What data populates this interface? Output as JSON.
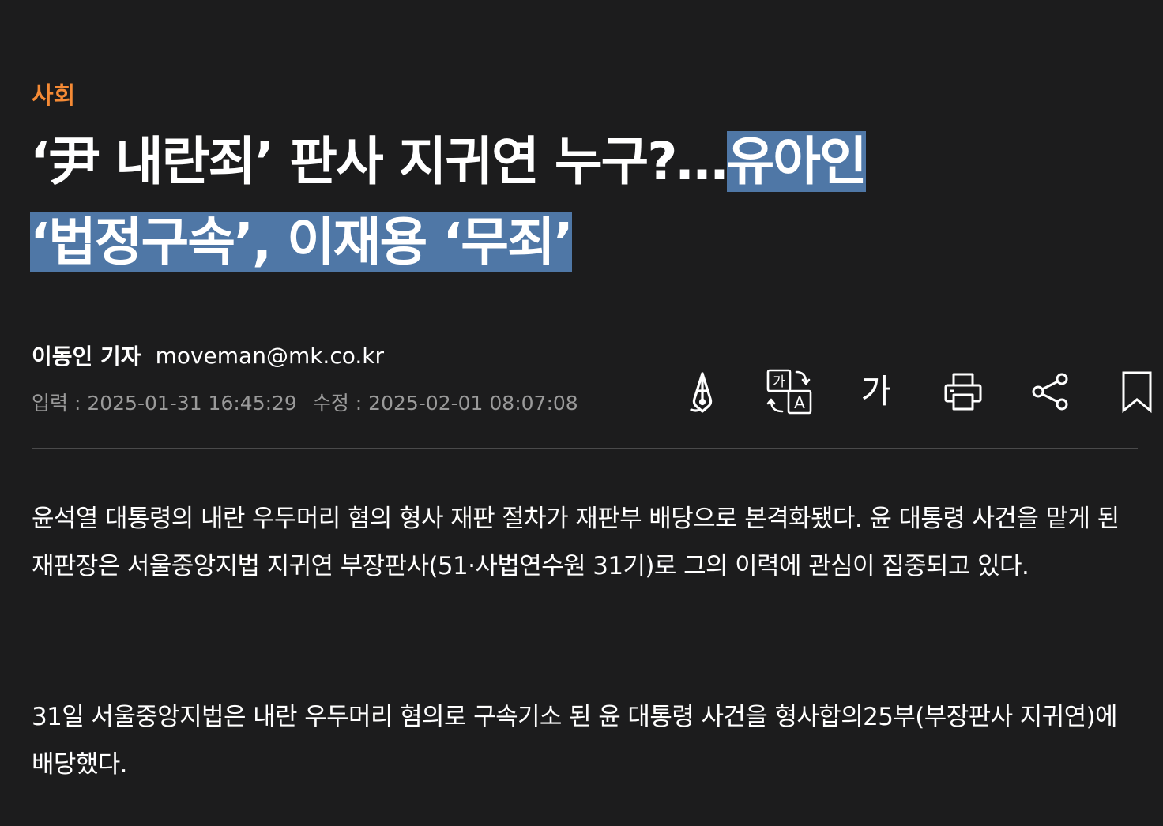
{
  "article": {
    "category": "사회",
    "headline_plain": "‘尹 내란죄’ 판사 지귀연 누구?…",
    "headline_selected_line1": "유아인",
    "headline_selected_line2": "‘법정구속’, 이재용 ‘무죄’",
    "reporter": "이동인 기자",
    "email": "moveman@mk.co.kr",
    "input_date": "입력 : 2025-01-31 16:45:29",
    "modified_date": "수정 : 2025-02-01 08:07:08",
    "paragraphs": [
      "윤석열 대통령의 내란 우두머리 혐의 형사 재판 절차가 재판부 배당으로 본격화됐다. 윤 대통령 사건을 맡게 된 재판장은 서울중앙지법 지귀연 부장판사(51·사법연수원 31기)로 그의 이력에 관심이 집중되고 있다.",
      "31일 서울중앙지법은 내란 우두머리 혐의로 구속기소 된 윤 대통령 사건을 형사합의25부(부장판사 지귀연)에 배당했다."
    ]
  },
  "toolbar": {
    "items": [
      {
        "name": "pen-nib-icon"
      },
      {
        "name": "translate-icon",
        "label": "가"
      },
      {
        "name": "font-size-icon",
        "label": "가"
      },
      {
        "name": "print-icon"
      },
      {
        "name": "share-icon"
      },
      {
        "name": "bookmark-icon"
      }
    ]
  },
  "colors": {
    "background": "#1c1c1d",
    "category": "#f58a35",
    "selection": "#4f77a6",
    "meta_text": "#9a9a9a"
  }
}
